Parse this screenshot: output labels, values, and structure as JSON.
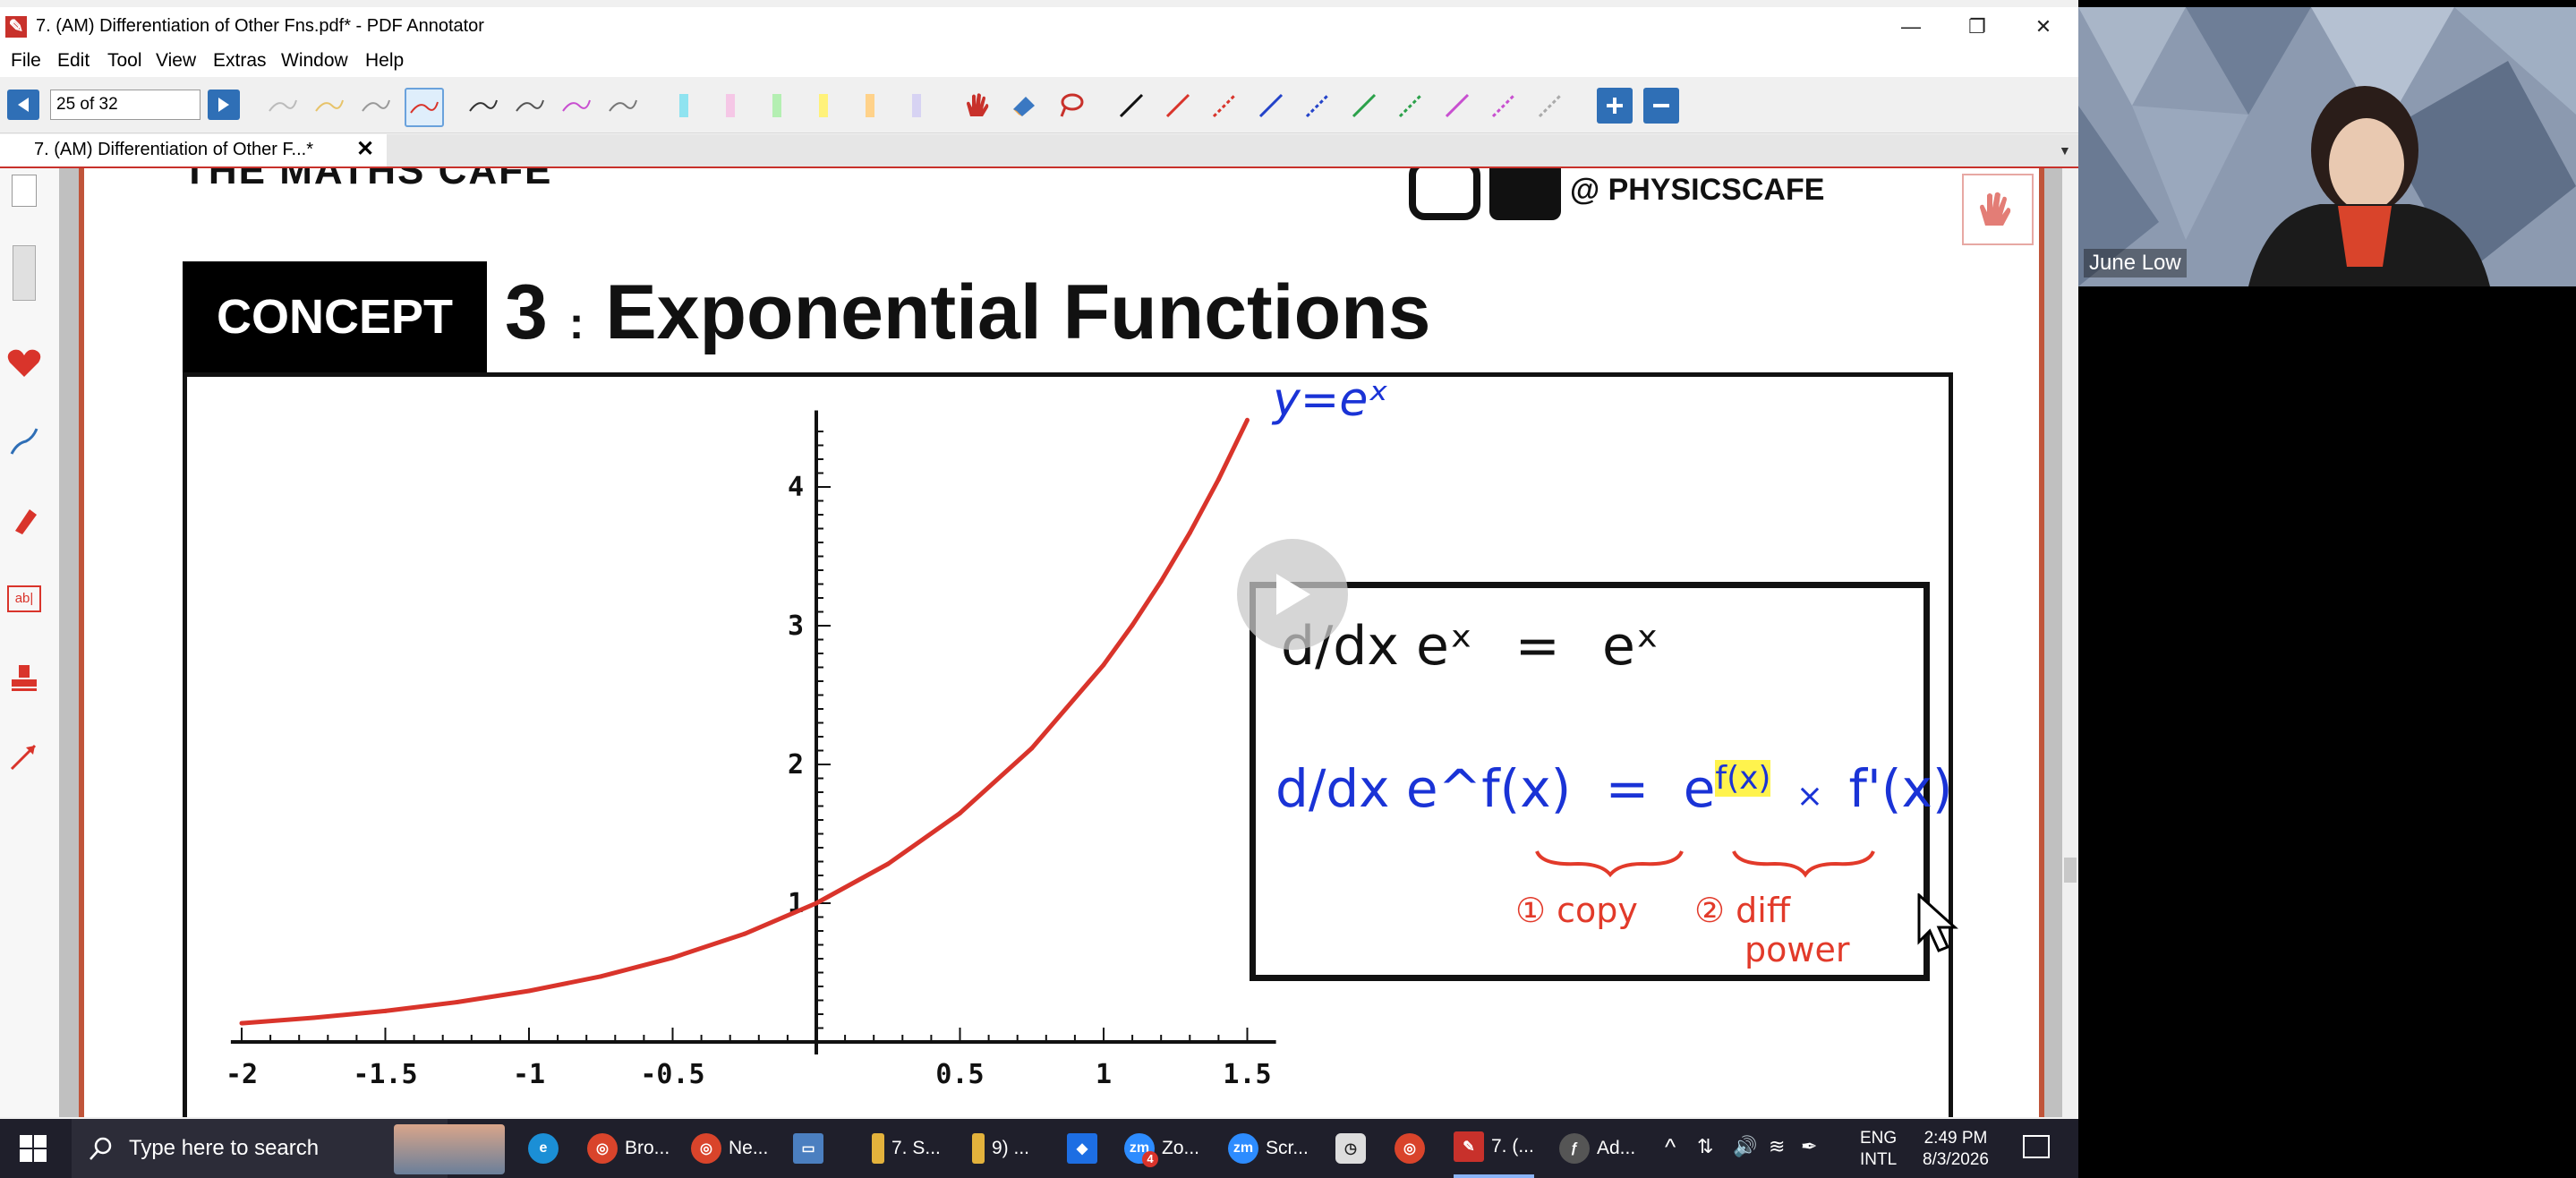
{
  "window": {
    "title": "7. (AM) Differentiation of Other Fns.pdf* - PDF Annotator",
    "app_icon": "pdf-annotator-icon"
  },
  "menu": [
    "File",
    "Edit",
    "Tool",
    "View",
    "Extras",
    "Window",
    "Help"
  ],
  "toolbar": {
    "page_indicator": "25 of 32"
  },
  "tab": {
    "title": "7. (AM) Differentiation of Other F...*",
    "close": "✕"
  },
  "document": {
    "header_left": "THE MATHS CAFE",
    "header_right": "@ PHYSICSCAFE",
    "concept_label": "CONCEPT",
    "concept_number": "3",
    "concept_separator": ":",
    "concept_title": "Exponential Functions"
  },
  "chart_data": {
    "type": "line",
    "title": "",
    "xlabel": "",
    "ylabel": "",
    "x_ticks": [
      "-2",
      "-1.5",
      "-1",
      "-0.5",
      "0.5",
      "1",
      "1.5"
    ],
    "y_ticks": [
      "1",
      "2",
      "3",
      "4"
    ],
    "xlim": [
      -2.1,
      1.6
    ],
    "ylim": [
      0,
      4.5
    ],
    "series": [
      {
        "name": "y=eˣ",
        "color": "#d9342b",
        "x": [
          -2,
          -1.75,
          -1.5,
          -1.25,
          -1,
          -0.75,
          -0.5,
          -0.25,
          0,
          0.25,
          0.5,
          0.75,
          1,
          1.1,
          1.2,
          1.3,
          1.4,
          1.5
        ],
        "y": [
          0.135,
          0.174,
          0.223,
          0.287,
          0.368,
          0.472,
          0.607,
          0.779,
          1,
          1.284,
          1.649,
          2.117,
          2.718,
          3.004,
          3.32,
          3.669,
          4.055,
          4.482
        ]
      }
    ],
    "annotation": "y=eˣ"
  },
  "formula_box": {
    "line1_lhs": "d/dx eˣ",
    "line1_eq": "=",
    "line1_rhs": "eˣ",
    "line2_lhs": "d/dx e^f(x)",
    "line2_eq": "=",
    "line2_rhs_base": "e",
    "line2_rhs_power": "f(x)",
    "line2_times": "×",
    "line2_deriv": "f'(x)",
    "step1": "① copy",
    "step2": "② diff",
    "step2b": "power"
  },
  "taskbar": {
    "search_placeholder": "Type here to search",
    "items": [
      "Bro...",
      "Ne...",
      "7. S...",
      "9) ...",
      "Zo...",
      "Scr...",
      "7. (...",
      "Ad..."
    ],
    "zoom_badge": "4",
    "lang_line1": "ENG",
    "lang_line2": "INTL",
    "time": "2:49 PM",
    "date": "8/3/2026"
  },
  "video": {
    "participant_name": "June Low"
  },
  "colors": {
    "accent_red": "#c8312b",
    "ink_blue": "#1a33d6",
    "ink_red": "#e23a2a",
    "highlight_yellow": "#fff34d",
    "taskbar_bg": "#1f1f2b"
  }
}
